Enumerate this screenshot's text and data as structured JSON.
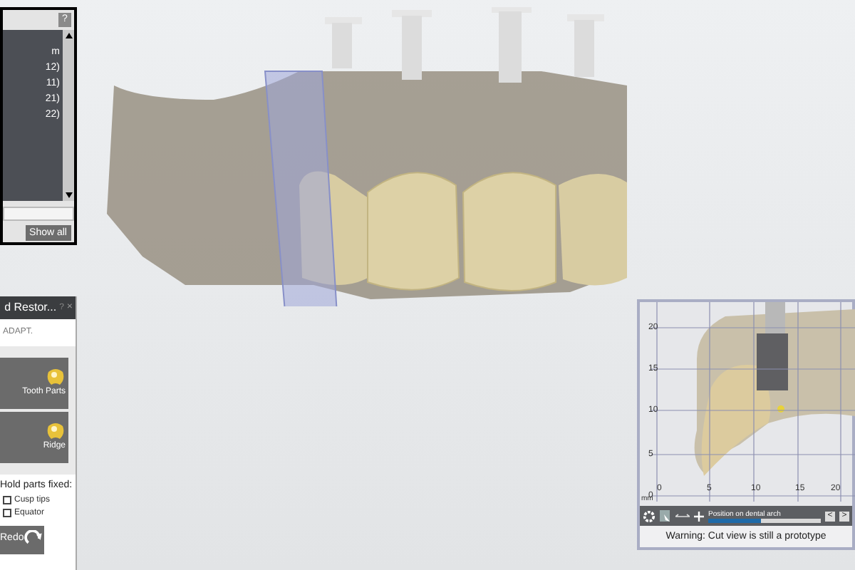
{
  "list_panel": {
    "help": "?",
    "items": [
      "m",
      "12)",
      "11)",
      "21)",
      "22)"
    ],
    "show_all": "Show all"
  },
  "restoration_panel": {
    "title": "d Restor...",
    "help": "?",
    "close": "×",
    "mode": "ADAPT.",
    "tools": [
      {
        "label": "Tooth Parts"
      },
      {
        "label": "Ridge"
      }
    ],
    "hold_label": "Hold parts fixed:",
    "options": [
      {
        "label": "Cusp tips",
        "checked": false
      },
      {
        "label": "Equator",
        "checked": false
      }
    ],
    "redo": "Redo"
  },
  "cut_view": {
    "y_ticks": [
      "20",
      "15",
      "10",
      "5",
      "0"
    ],
    "x_ticks": [
      "0",
      "5",
      "10",
      "15",
      "20"
    ],
    "unit": "mm",
    "slider_label": "Position on dental arch",
    "level": 0.47,
    "prev": "<",
    "next": ">",
    "warning": "Warning: Cut view is still a prototype"
  }
}
